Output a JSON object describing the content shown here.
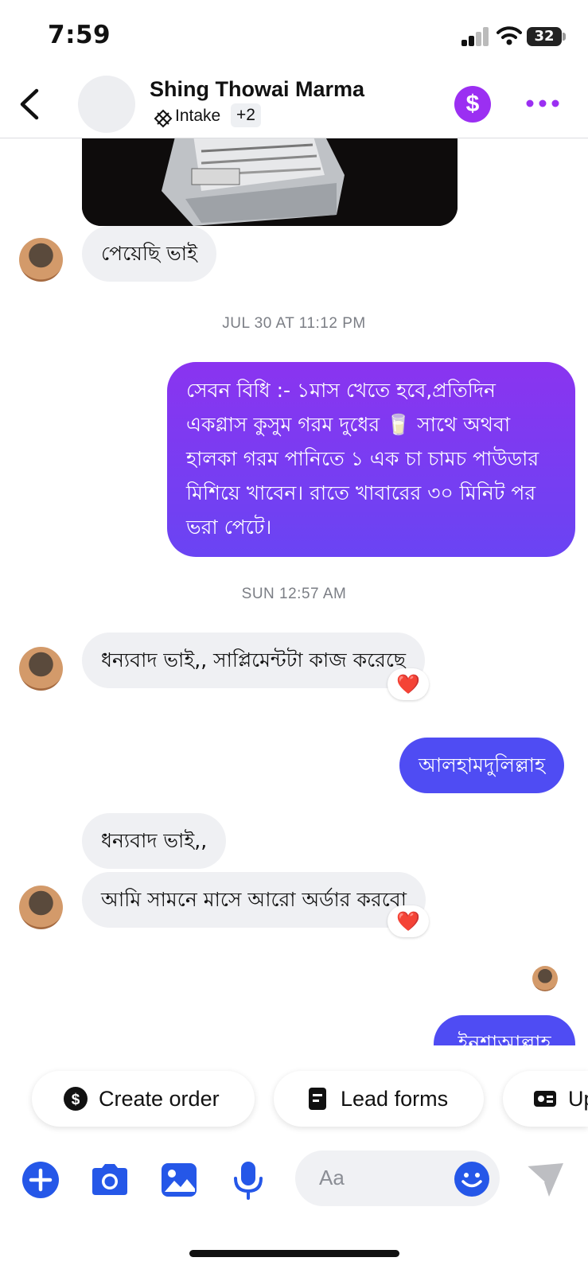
{
  "status_bar": {
    "time": "7:59",
    "battery": "32"
  },
  "header": {
    "contact_name": "Shing Thowai Marma",
    "label": "Intake",
    "label_more": "+2",
    "pay_icon": "dollar-circle-icon"
  },
  "messages": {
    "m1": "পেয়েছি ভাই",
    "ts1": "JUL 30 AT 11:12 PM",
    "m2_lines": [
      "সেবন বিধি :- ১মাস খেতে হবে,প্রতিদিন",
      "একগ্লাস কুসুম গরম দুধের 🥛 সাথে অথবা",
      "হালকা গরম পানিতে ১ এক চা চামচ পাউডার",
      "মিশিয়ে খাবেন। রাতে খাবারের ৩০ মিনিট পর",
      "ভরা পেটে।"
    ],
    "ts2": "SUN 12:57 AM",
    "m3": "ধন্যবাদ ভাই,, সাপ্লিমেন্টটা কাজ করেছে",
    "m3_reaction": "❤️",
    "m4": "আলহামদুলিল্লাহ",
    "m5": "ধন্যবাদ ভাই,,",
    "m6": "আমি সামনে মাসে আরো অর্ডার করবো",
    "m6_reaction": "❤️",
    "m7": "ইনশাআল্লাহ"
  },
  "quick_actions": {
    "create_order": "Create order",
    "lead_forms": "Lead forms",
    "third": "Up"
  },
  "composer": {
    "placeholder": "Aa"
  },
  "colors": {
    "outgoing": "#4f4cf3",
    "accent_purple": "#9b2ff2",
    "icon_blue": "#2557e8"
  }
}
